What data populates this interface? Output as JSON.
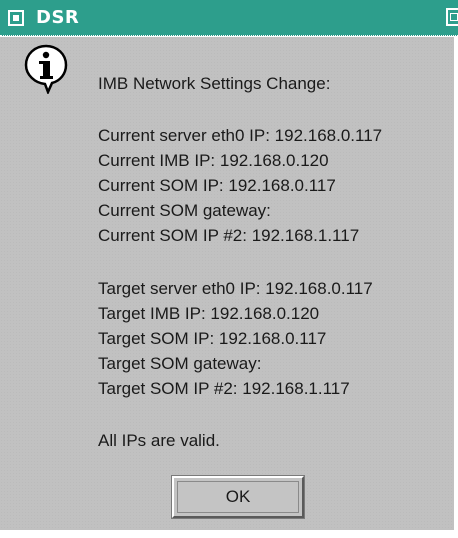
{
  "window": {
    "title": "DSR"
  },
  "dialog": {
    "icon": "info-icon",
    "heading": "IMB Network Settings Change:",
    "current": [
      "Current server eth0 IP: 192.168.0.117",
      "Current IMB IP: 192.168.0.120",
      "Current SOM IP: 192.168.0.117",
      "Current SOM gateway:",
      "Current SOM IP #2: 192.168.1.117"
    ],
    "target": [
      "Target server eth0 IP: 192.168.0.117",
      "Target IMB IP: 192.168.0.120",
      "Target SOM IP: 192.168.0.117",
      "Target SOM gateway:",
      "Target SOM IP #2: 192.168.1.117"
    ],
    "status": "All IPs are valid.",
    "ok_label": "OK"
  },
  "colors": {
    "titlebar": "#2d9e8c",
    "dialog_bg": "#c1c1c1"
  }
}
